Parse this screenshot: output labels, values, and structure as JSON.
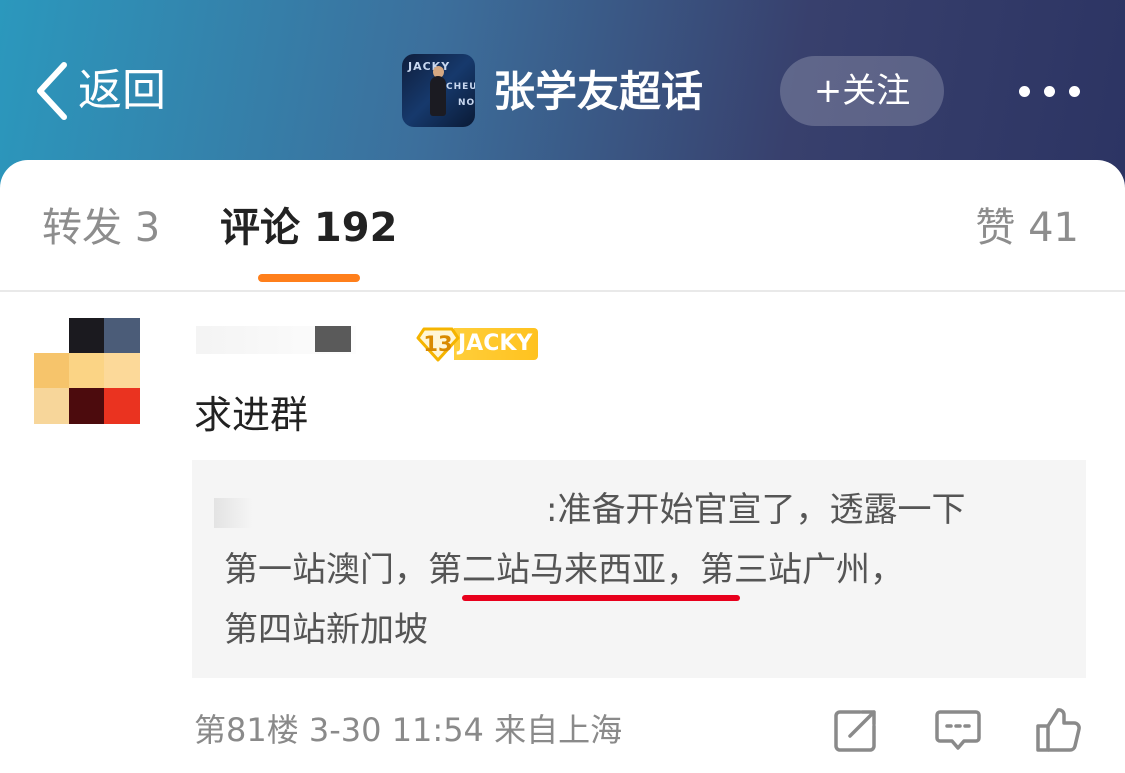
{
  "header": {
    "back_label": "返回",
    "topic_title": "张学友超话",
    "topic_avatar_text": [
      "JACKY",
      "CHEUNG",
      "NO"
    ],
    "follow_label": "+关注"
  },
  "tabs": {
    "repost": "转发 3",
    "comment": "评论 192",
    "like": "赞 41",
    "active": "comment"
  },
  "comment": {
    "fan_badge": {
      "level": "13",
      "name": "JACKY"
    },
    "text": "求进群",
    "quote": {
      "line1": ":准备开始官宣了，透露一下",
      "line2": "第一站澳门，第二站马来西亚，第三站广州，",
      "line3": "第四站新加坡"
    },
    "meta": "第81楼  3-30 11:54  来自上海"
  },
  "colors": {
    "accent": "#ff7f1b",
    "badge_yellow": "#ffc21f",
    "annotation_red": "#e8001c"
  },
  "icons": {
    "back": "chevron-left-icon",
    "more": "more-dots-icon",
    "share": "share-icon",
    "reply": "comment-icon",
    "like": "thumbs-up-icon"
  }
}
